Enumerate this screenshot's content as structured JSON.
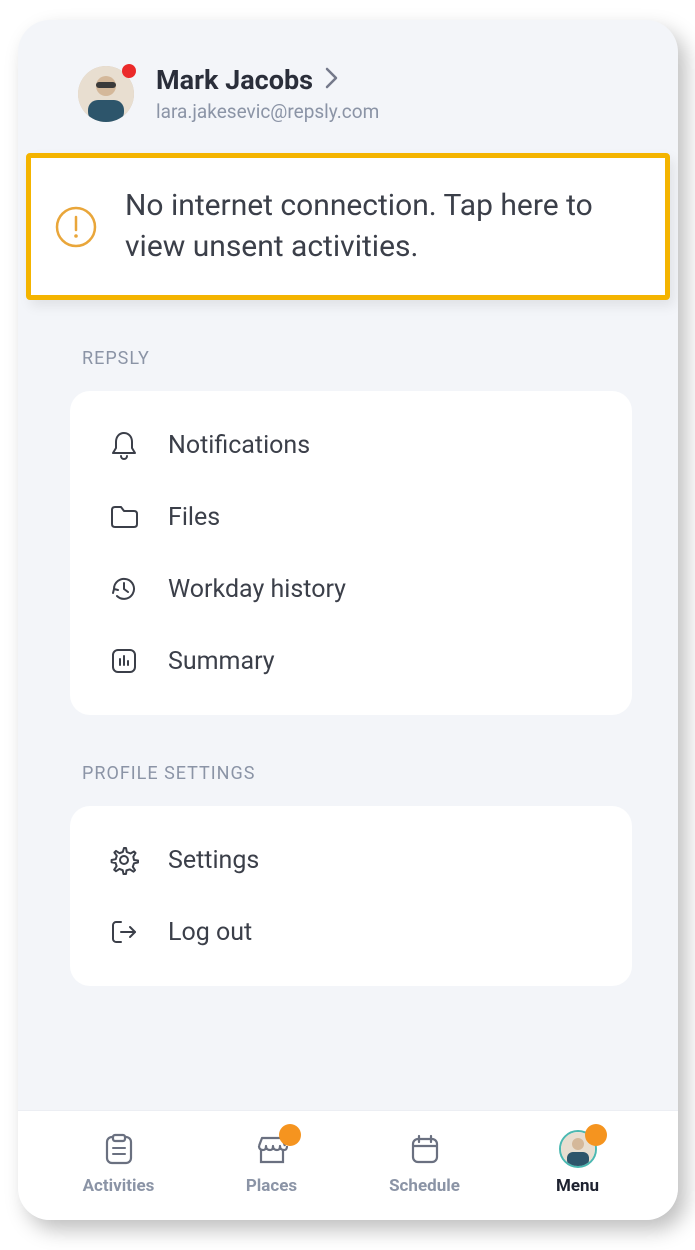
{
  "profile": {
    "name": "Mark Jacobs",
    "email": "lara.jakesevic@repsly.com"
  },
  "alert": {
    "message": "No internet connection. Tap here to view unsent activities."
  },
  "sections": {
    "repsly": {
      "label": "REPSLY",
      "items": [
        {
          "icon": "bell",
          "label": "Notifications"
        },
        {
          "icon": "folder",
          "label": "Files"
        },
        {
          "icon": "history",
          "label": "Workday history"
        },
        {
          "icon": "chart",
          "label": "Summary"
        }
      ]
    },
    "profile_settings": {
      "label": "PROFILE SETTINGS",
      "items": [
        {
          "icon": "gear",
          "label": "Settings"
        },
        {
          "icon": "logout",
          "label": "Log out"
        }
      ]
    }
  },
  "nav": {
    "items": [
      {
        "key": "activities",
        "label": "Activities",
        "badge": false,
        "active": false
      },
      {
        "key": "places",
        "label": "Places",
        "badge": true,
        "active": false
      },
      {
        "key": "schedule",
        "label": "Schedule",
        "badge": false,
        "active": false
      },
      {
        "key": "menu",
        "label": "Menu",
        "badge": true,
        "active": true
      }
    ]
  },
  "colors": {
    "accent_orange": "#f5941f",
    "alert_border": "#f4b400",
    "status_red": "#eb2a2a"
  }
}
